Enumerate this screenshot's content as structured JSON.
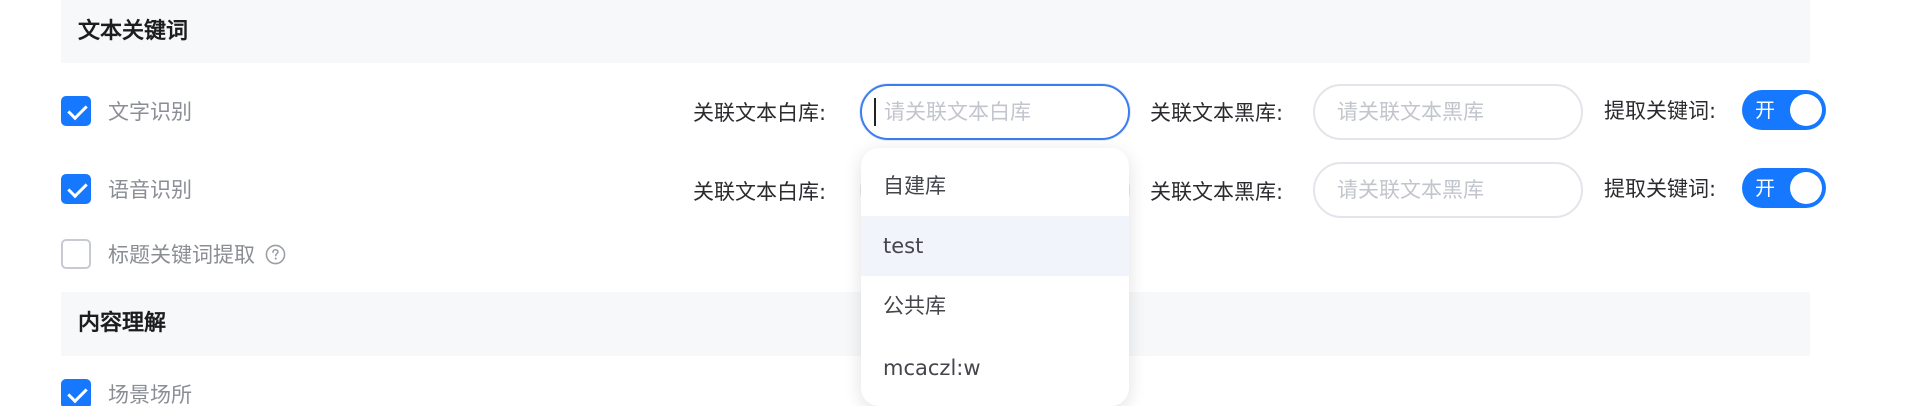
{
  "sections": {
    "text_keywords": {
      "title": "文本关键词"
    },
    "content_understanding": {
      "title": "内容理解"
    }
  },
  "rows": {
    "ocr": {
      "label": "文字识别",
      "checked": true
    },
    "asr": {
      "label": "语音识别",
      "checked": true
    },
    "title_keyword": {
      "label": "标题关键词提取",
      "checked": false,
      "icon": "help-circle-icon"
    },
    "scene": {
      "label": "场景场所",
      "checked": true
    }
  },
  "fields": {
    "whitelist_label": "关联文本白库:",
    "whitelist_placeholder": "请关联文本白库",
    "blacklist_label": "关联文本黑库:",
    "blacklist_placeholder": "请关联文本黑库",
    "extract_label": "提取关键词:",
    "toggle_on_text": "开"
  },
  "dropdown": {
    "options": [
      "自建库",
      "test",
      "公共库",
      "mcaczl:w"
    ],
    "hovered": "test"
  },
  "colors": {
    "accent": "#1677ff",
    "focus_border": "#3b7cf0",
    "section_bg": "#f7f8fa",
    "hover_bg": "#f1f4fb"
  }
}
